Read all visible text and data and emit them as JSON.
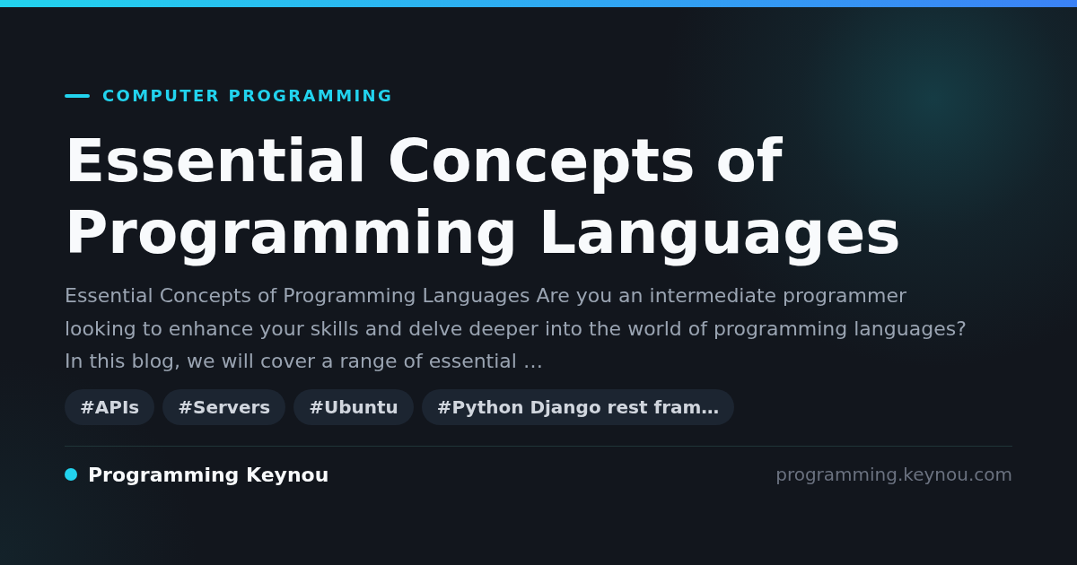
{
  "kicker": "COMPUTER PROGRAMMING",
  "title": "Essential Concepts of Programming Languages",
  "description": "Essential Concepts of Programming Languages Are you an intermediate programmer looking to enhance your skills and delve deeper into the world of programming languages? In this blog, we will cover a range of essential …",
  "tags": [
    "#APIs",
    "#Servers",
    "#Ubuntu",
    "#Python Django rest fram…"
  ],
  "footer": {
    "site_name": "Programming Keynou",
    "domain": "programming.keynou.com"
  }
}
